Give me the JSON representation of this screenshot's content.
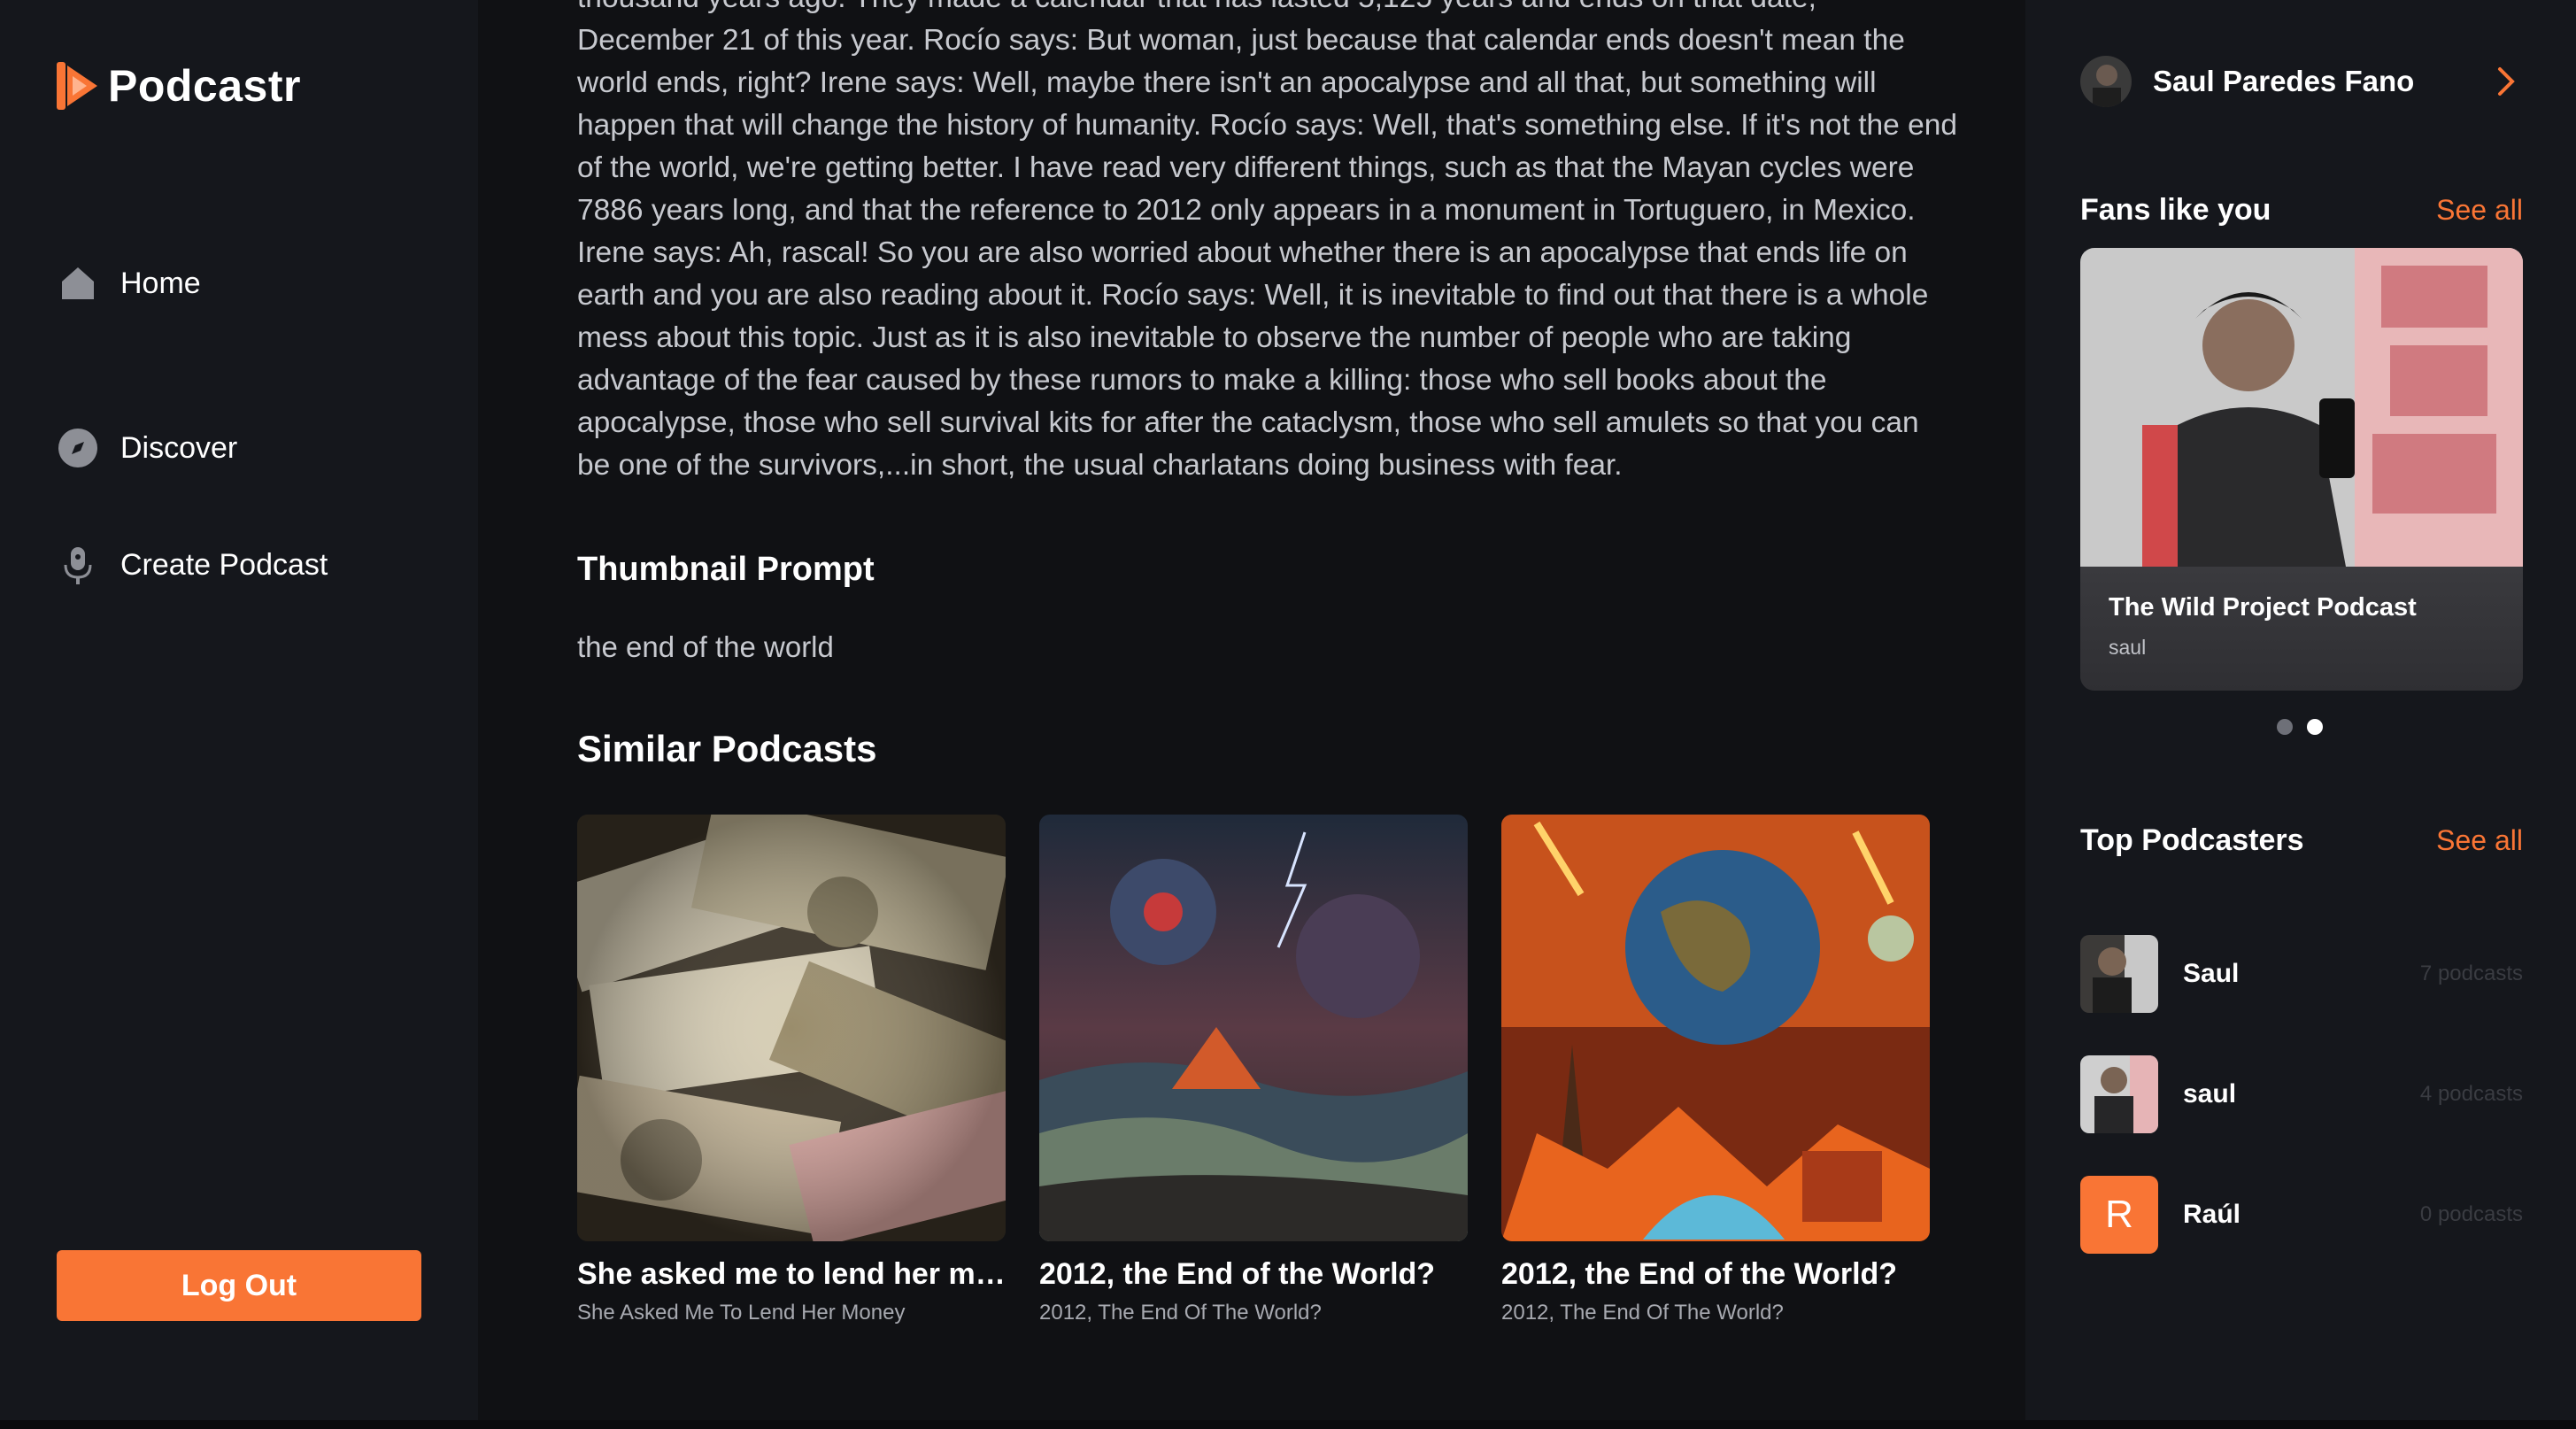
{
  "app": {
    "name": "Podcastr"
  },
  "nav": {
    "items": [
      {
        "label": "Home",
        "icon": "home-icon"
      },
      {
        "label": "Discover",
        "icon": "compass-icon"
      },
      {
        "label": "Create Podcast",
        "icon": "microphone-icon"
      }
    ],
    "logout_label": "Log Out"
  },
  "main": {
    "transcript": "thousand years ago. They made a calendar that has lasted 5,125 years and ends on that date, December 21 of this year. Rocío says: But woman, just because that calendar ends doesn't mean the world ends, right? Irene says: Well, maybe there isn't an apocalypse and all that, but something will happen that will change the history of humanity. Rocío says: Well, that's something else. If it's not the end of the world, we're getting better. I have read very different things, such as that the Mayan cycles were 7886 years long, and that the reference to 2012 only appears in a monument in Tortuguero, in Mexico. Irene says: Ah, rascal! So you are also worried about whether there is an apocalypse that ends life on earth and you are also reading about it. Rocío says: Well, it is inevitable to find out that there is a whole mess about this topic. Just as it is also inevitable to observe the number of people who are taking advantage of the fear caused by these rumors to make a killing: those who sell books about the apocalypse, those who sell survival kits for after the cataclysm, those who sell amulets so that you can be one of the survivors,...in short, the usual charlatans doing business with fear.",
    "thumbnail_prompt_title": "Thumbnail Prompt",
    "thumbnail_prompt": "the end of the world",
    "similar_title": "Similar Podcasts",
    "similar": [
      {
        "title": "She asked me to lend her money",
        "subtitle": "She Asked Me To Lend Her Money"
      },
      {
        "title": "2012, the End of the World?",
        "subtitle": "2012, The End Of The World?"
      },
      {
        "title": "2012, the End of the World?",
        "subtitle": "2012, The End Of The World?"
      }
    ]
  },
  "right": {
    "user_name": "Saul Paredes Fano",
    "fans": {
      "title": "Fans like you",
      "see_all": "See all",
      "card_title": "The Wild Project Podcast",
      "card_author": "saul"
    },
    "top": {
      "title": "Top Podcasters",
      "see_all": "See all",
      "items": [
        {
          "name": "Saul",
          "count": "7 podcasts"
        },
        {
          "name": "saul",
          "count": "4 podcasts"
        },
        {
          "name": "Raúl",
          "count": "0 podcasts",
          "initial": "R"
        }
      ]
    }
  },
  "colors": {
    "accent": "#f97535",
    "background": "#101114",
    "panel": "#15171c"
  }
}
